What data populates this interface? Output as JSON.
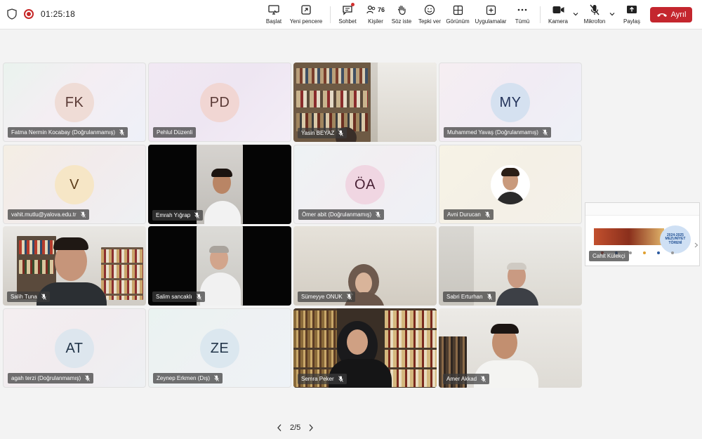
{
  "toolbar": {
    "timer": "01:25:18",
    "participants_count": "76",
    "buttons": {
      "baslat": "Başlat",
      "yeni_pencere": "Yeni pencere",
      "sohbet": "Sohbet",
      "kisiler": "Kişiler",
      "soz_iste": "Söz iste",
      "tepki_ver": "Tepki ver",
      "gorunum": "Görünüm",
      "uygulamalar": "Uygulamalar",
      "tumu": "Tümü",
      "kamera": "Kamera",
      "mikrofon": "Mikrofon",
      "paylas": "Paylaş",
      "ayril": "Ayrıl"
    },
    "colors": {
      "leave": "#c4262e",
      "record": "#c62828"
    }
  },
  "tiles": [
    {
      "initials": "FK",
      "name": "Fatma Nermin Kocabay (Doğrulanmamış)",
      "avatar_color": "#efdcd6"
    },
    {
      "initials": "PD",
      "name": "Pehlul Düzenli",
      "avatar_color": "#f1d6d3"
    },
    {
      "name": "Yasin BEYAZ"
    },
    {
      "initials": "MY",
      "name": "Muhammed Yavaş (Doğrulanmamış)",
      "avatar_color": "#d5e1f0"
    },
    {
      "initials": "V",
      "name": "vahit.mutlu@yalova.edu.tr",
      "avatar_color": "#f6e6c6"
    },
    {
      "name": "Emrah Yığrap"
    },
    {
      "initials": "ÖA",
      "name": "Ömer abit (Doğrulanmamış)",
      "avatar_color": "#f0d6e2"
    },
    {
      "name": "Avni Durucan"
    },
    {
      "name": "Salih Tuna"
    },
    {
      "name": "Salim sancaklı"
    },
    {
      "name": "Sümeyye ONUK"
    },
    {
      "name": "Sabri Erturhan"
    },
    {
      "initials": "AT",
      "name": "agah terzi (Doğrulanmamış)",
      "avatar_color": "#dde6ee"
    },
    {
      "initials": "ZE",
      "name": "Zeynep Erkmen (Dış)",
      "avatar_color": "#dbe7ef"
    },
    {
      "name": "Semra Peker"
    },
    {
      "name": "Amer Akkad"
    }
  ],
  "side_share": {
    "name": "Cahit Külekçi",
    "badge_text": "2024-2025 MEZUNİYET TÖRENİ"
  },
  "pager": {
    "current": "2/5"
  }
}
